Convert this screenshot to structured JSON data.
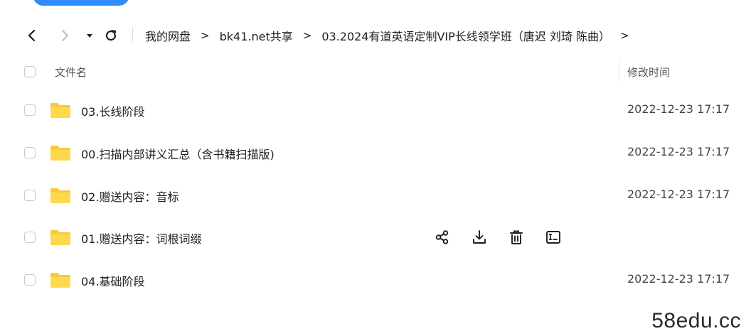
{
  "breadcrumbs": [
    "我的网盘",
    "bk41.net共享",
    "03.2024有道英语定制VIP长线领学班（唐迟 刘琦 陈曲）"
  ],
  "breadcrumb_separator": ">",
  "header": {
    "name_label": "文件名",
    "time_label": "修改时间"
  },
  "rows": [
    {
      "name": "03.长线阶段",
      "time": "2022-12-23 17:17"
    },
    {
      "name": "00.扫描内部讲义汇总（含书籍扫描版)",
      "time": "2022-12-23 17:17"
    },
    {
      "name": "02.赠送内容：音标",
      "time": "2022-12-23 17:17"
    },
    {
      "name": "01.赠送内容：词根词缀",
      "time": ""
    },
    {
      "name": "04.基础阶段",
      "time": "2022-12-23 17:17"
    }
  ],
  "hover_actions": [
    "share-icon",
    "download-icon",
    "delete-icon",
    "rename-icon"
  ],
  "colors": {
    "accent": "#2f8bff",
    "folder": "#f8c93a"
  },
  "watermark": "58edu.cc"
}
